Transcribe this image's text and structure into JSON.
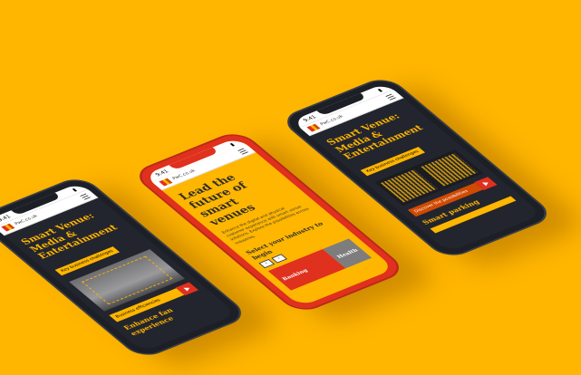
{
  "background_color": "#FFB600",
  "phones": {
    "left": {
      "status_time": "9:41",
      "browser_label": "PwC.co.uk",
      "headline": "Smart Venue: Media & Entertainment",
      "tag": "Key business challenges",
      "venue_tag": "Business efficiencies",
      "card_label": "Business efficiencies",
      "section_title": "Enhance fan experience"
    },
    "center": {
      "status_time": "9:41",
      "browser_label": "PwC.co.uk",
      "headline": "Lead the future of smart venues",
      "body": "Enhance the digital and physical customer experience with smart venue solutions. Explore the possibilities across industries.",
      "select_label": "Select your industry to begin",
      "industries": [
        "Banking",
        "Health"
      ]
    },
    "right": {
      "status_time": "9:41",
      "browser_label": "PwC.co.uk",
      "headline": "Smart Venue: Media & Entertainment",
      "tag": "Key business challenges",
      "card_label": "Discover the possibilities",
      "section_title": "Smart parking"
    }
  }
}
